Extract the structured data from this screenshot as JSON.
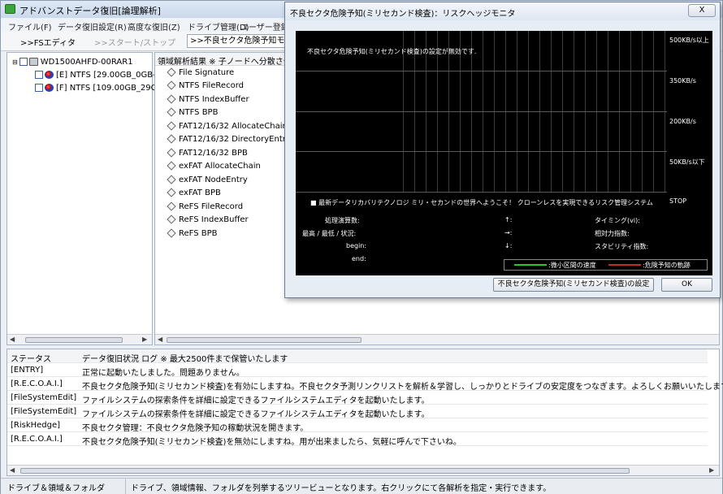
{
  "app": {
    "title": "アドバンストデータ復旧[論理解析]"
  },
  "menubar": {
    "items": [
      "ファイル(F)",
      "データ復旧設定(R)",
      "高度な復旧(Z)",
      "ドライブ管理(D)",
      "ユーザー登録(U)"
    ]
  },
  "tabs": {
    "items": [
      ">>FSエディタ",
      ">>スタート/ストップ",
      ">>不良セクタ危険予知モニタ"
    ]
  },
  "tree": {
    "items": [
      {
        "label": "WD1500AHFD-00RAR1",
        "icon": "hard-disk-icon",
        "level": 0
      },
      {
        "label": "[E] NTFS [29.00GB_0GB-",
        "icon": "partition-icon",
        "level": 1
      },
      {
        "label": "[F] NTFS [109.00GB_29G",
        "icon": "partition-icon",
        "level": 1
      }
    ]
  },
  "list": {
    "header": "領域解析結果 ※ 子ノードへ分散させて",
    "items": [
      "File Signature",
      "NTFS FileRecord",
      "NTFS IndexBuffer",
      "NTFS BPB",
      "FAT12/16/32 AllocateChain",
      "FAT12/16/32 DirectoryEntry",
      "FAT12/16/32 BPB",
      "exFAT AllocateChain",
      "exFAT NodeEntry",
      "exFAT BPB",
      "ReFS FileRecord",
      "ReFS IndexBuffer",
      "ReFS BPB"
    ]
  },
  "log": {
    "header": {
      "status": "ステータス",
      "message": "データ復旧状況 ログ ※ 最大2500件まで保管いたします"
    },
    "rows": [
      {
        "status": "[ENTRY]",
        "message": "正常に起動いたしました。問題ありません。"
      },
      {
        "status": "[R.E.C.O.A.I.]",
        "message": "不良セクタ危険予知(ミリセカンド検査)を有効にしますね。不良セクタ予測リンクリストを解析＆学習し、しっかりとドライブの安定度をつなぎます。よろしくお願いいたします。"
      },
      {
        "status": "[FileSystemEdit]",
        "message": "ファイルシステムの探索条件を詳細に設定できるファイルシステムエディタを起動いたします。"
      },
      {
        "status": "[FileSystemEdit]",
        "message": "ファイルシステムの探索条件を詳細に設定できるファイルシステムエディタを起動いたします。"
      },
      {
        "status": "[RiskHedge]",
        "message": "不良セクタ管理：不良セクタ危険予知の稼動状況を開きます。"
      },
      {
        "status": "[R.E.C.O.A.I.]",
        "message": "不良セクタ危険予知(ミリセカンド検査)を無効にしますね。用が出来ましたら、気軽に呼んで下さいね。"
      }
    ]
  },
  "statusbar": {
    "left": "ドライブ＆領域＆フォルダ",
    "right": "ドライブ、領域情報、フォルダを列挙するツリービューとなります。右クリックにて各解析を指定・実行できます。"
  },
  "modal": {
    "title": "不良セクタ危険予知(ミリセカンド検査)：リスクヘッジモニタ",
    "close_label": "X",
    "disabled_message": "不良セクタ危険予知(ミリセカンド検査)の設定が無効です.",
    "scale_labels": [
      "500KB/s以上",
      "350KB/s",
      "200KB/s",
      "50KB/s以下",
      "STOP"
    ],
    "welcome": "■ 最新データリカバリテクノロジ ミリ・セカンドの世界へようこそ！ クローンレスを実現できるリスク管理システム",
    "stats_left": [
      "処理演算数:",
      "最高 / 最低 / 状況:",
      "begin:",
      "end:"
    ],
    "stats_mid": [
      "↑:",
      "→:",
      "↓:"
    ],
    "stats_right": [
      "タイミング(vi):",
      "相対力指数:",
      "スタビリティ指数:"
    ],
    "legend": [
      {
        "label": ":微小区間の速度",
        "color": "#22cc22"
      },
      {
        "label": ":危険予知の軌跡",
        "color": "#c03020"
      }
    ],
    "settings_button": "不良セクタ危険予知(ミリセカンド検査)の設定",
    "ok_button": "OK"
  }
}
